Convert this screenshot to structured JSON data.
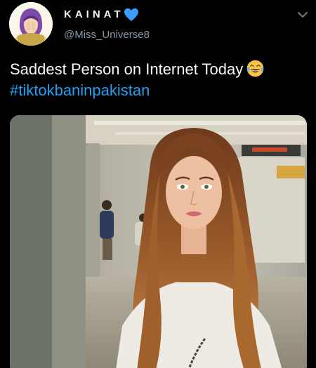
{
  "user": {
    "display_name": "KAINAT",
    "handle": "@Miss_Universe8",
    "avatar_icon": "avatar-girl-hijab-icon",
    "badge_icon": "blue-heart-icon",
    "badge_color": "#3b9bff"
  },
  "tweet": {
    "text": "Saddest Person on Internet Today",
    "emoji_icon": "face-with-tears-of-joy-icon",
    "hashtag": "#tiktokbaninpakistan",
    "hashtag_color": "#1da1f2"
  },
  "menu": {
    "icon": "chevron-down-icon"
  },
  "media": {
    "description_icon": "photo-woman-in-station"
  }
}
